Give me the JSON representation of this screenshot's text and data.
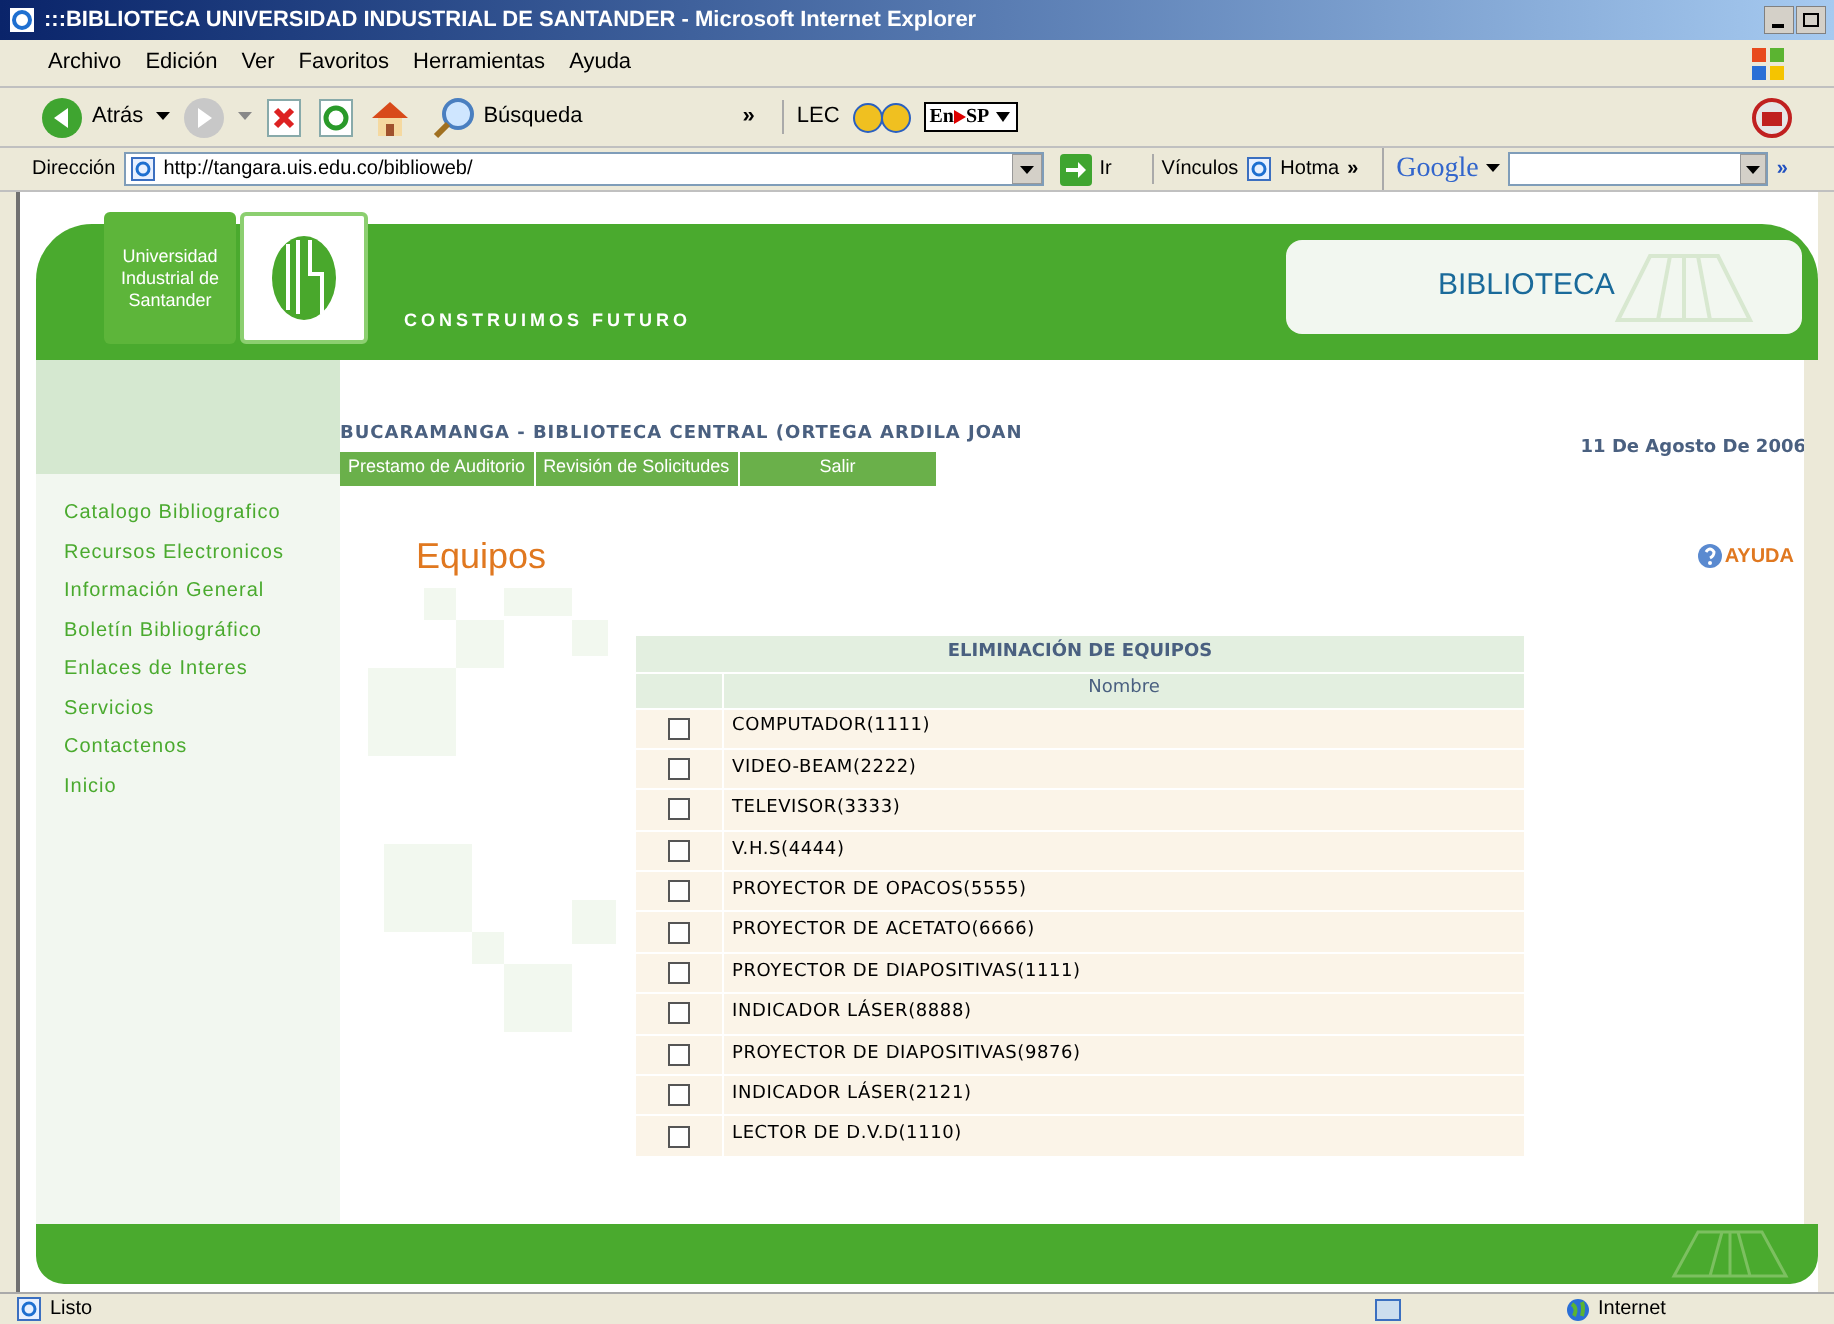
{
  "window": {
    "title": ":::BIBLIOTECA UNIVERSIDAD INDUSTRIAL DE SANTANDER - Microsoft Internet Explorer"
  },
  "menu": [
    "Archivo",
    "Edición",
    "Ver",
    "Favoritos",
    "Herramientas",
    "Ayuda"
  ],
  "toolbar": {
    "back": "Atrás",
    "search": "Búsqueda",
    "more": "»",
    "lec": "LEC",
    "translate_from": "En",
    "translate_to": "SP"
  },
  "address_bar": {
    "label": "Dirección",
    "url": "http://tangara.uis.edu.co/biblioweb/",
    "go": "Ir",
    "links": "Vínculos",
    "link_item": "Hotma",
    "more": "»",
    "google": "Google",
    "more_right": "»"
  },
  "header": {
    "logo_text": "Universidad Industrial de Santander",
    "slogan": "CONSTRUIMOS FUTURO",
    "section": "BIBLIOTECA"
  },
  "location": "BUCARAMANGA - BIBLIOTECA CENTRAL (ORTEGA ARDILA JOAN",
  "date": "11 De Agosto De 2006",
  "nav": [
    "Prestamo de Auditorio",
    "Revisión de Solicitudes",
    "Salir"
  ],
  "sidebar": {
    "items": [
      "Catalogo Bibliografico",
      "Recursos Electronicos",
      "Información General",
      "Boletín Bibliográfico",
      "Enlaces de Interes",
      "Servicios",
      "Contactenos",
      "Inicio"
    ]
  },
  "heading": "Equipos",
  "help": "AYUDA",
  "table": {
    "title": "ELIMINACIÓN DE EQUIPOS",
    "columns": [
      "Nombre"
    ],
    "rows": [
      {
        "name": "COMPUTADOR(1111)",
        "checked": false
      },
      {
        "name": "VIDEO-BEAM(2222)",
        "checked": false
      },
      {
        "name": "TELEVISOR(3333)",
        "checked": false
      },
      {
        "name": "V.H.S(4444)",
        "checked": false
      },
      {
        "name": "PROYECTOR DE OPACOS(5555)",
        "checked": false
      },
      {
        "name": "PROYECTOR DE ACETATO(6666)",
        "checked": false
      },
      {
        "name": "PROYECTOR DE DIAPOSITIVAS(1111)",
        "checked": false
      },
      {
        "name": "INDICADOR LÁSER(8888)",
        "checked": false
      },
      {
        "name": "PROYECTOR DE DIAPOSITIVAS(9876)",
        "checked": false
      },
      {
        "name": "INDICADOR LÁSER(2121)",
        "checked": false
      },
      {
        "name": "LECTOR DE D.V.D(1110)",
        "checked": false
      }
    ]
  },
  "status_bar": {
    "text": "Listo",
    "zone": "Internet"
  }
}
